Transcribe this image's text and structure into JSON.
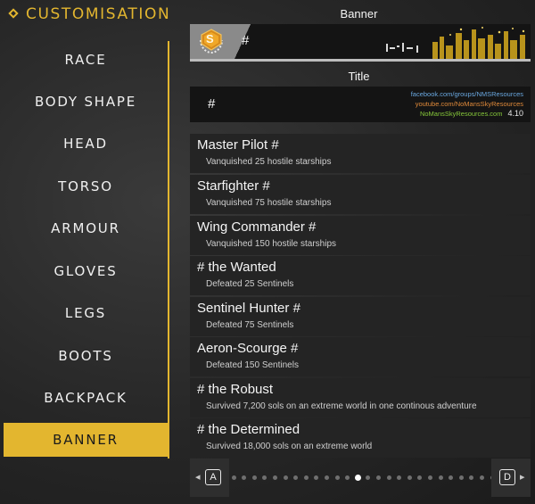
{
  "header": {
    "title": "CUSTOMISATION",
    "icon": "diamond-icon",
    "accent_color": "#e3b62f"
  },
  "sidebar": {
    "items": [
      {
        "label": "RACE"
      },
      {
        "label": "BODY SHAPE"
      },
      {
        "label": "HEAD"
      },
      {
        "label": "TORSO"
      },
      {
        "label": "ARMOUR"
      },
      {
        "label": "GLOVES"
      },
      {
        "label": "LEGS"
      },
      {
        "label": "BOOTS"
      },
      {
        "label": "BACKPACK"
      },
      {
        "label": "BANNER",
        "active": true
      }
    ]
  },
  "banner": {
    "section_label": "Banner",
    "text": "#",
    "badge_letter": "S",
    "badge_icon": "s-class-badge-icon"
  },
  "title_section": {
    "section_label": "Title",
    "text": "#",
    "watermark": {
      "line1": "facebook.com/groups/NMSResources",
      "line2": "youtube.com/NoMansSkyResources",
      "line3": "NoMansSkyResources.com",
      "version": "4.10"
    }
  },
  "titles": [
    {
      "name": "Master Pilot #",
      "desc": "Vanquished 25 hostile starships"
    },
    {
      "name": "Starfighter #",
      "desc": "Vanquished 75 hostile starships"
    },
    {
      "name": "Wing Commander #",
      "desc": "Vanquished 150 hostile starships"
    },
    {
      "name": "# the Wanted",
      "desc": "Defeated 25 Sentinels"
    },
    {
      "name": "Sentinel Hunter #",
      "desc": "Defeated 75 Sentinels"
    },
    {
      "name": "Aeron-Scourge #",
      "desc": "Defeated 150 Sentinels"
    },
    {
      "name": "# the Robust",
      "desc": "Survived 7,200 sols on an extreme world in one continous adventure"
    },
    {
      "name": "# the Determined",
      "desc": "Survived 18,000 sols on an extreme world"
    }
  ],
  "pager": {
    "prev_key": "A",
    "next_key": "D",
    "prev_icon": "chevron-left-icon",
    "next_icon": "chevron-right-icon",
    "page_count": 26,
    "current_page": 12
  }
}
